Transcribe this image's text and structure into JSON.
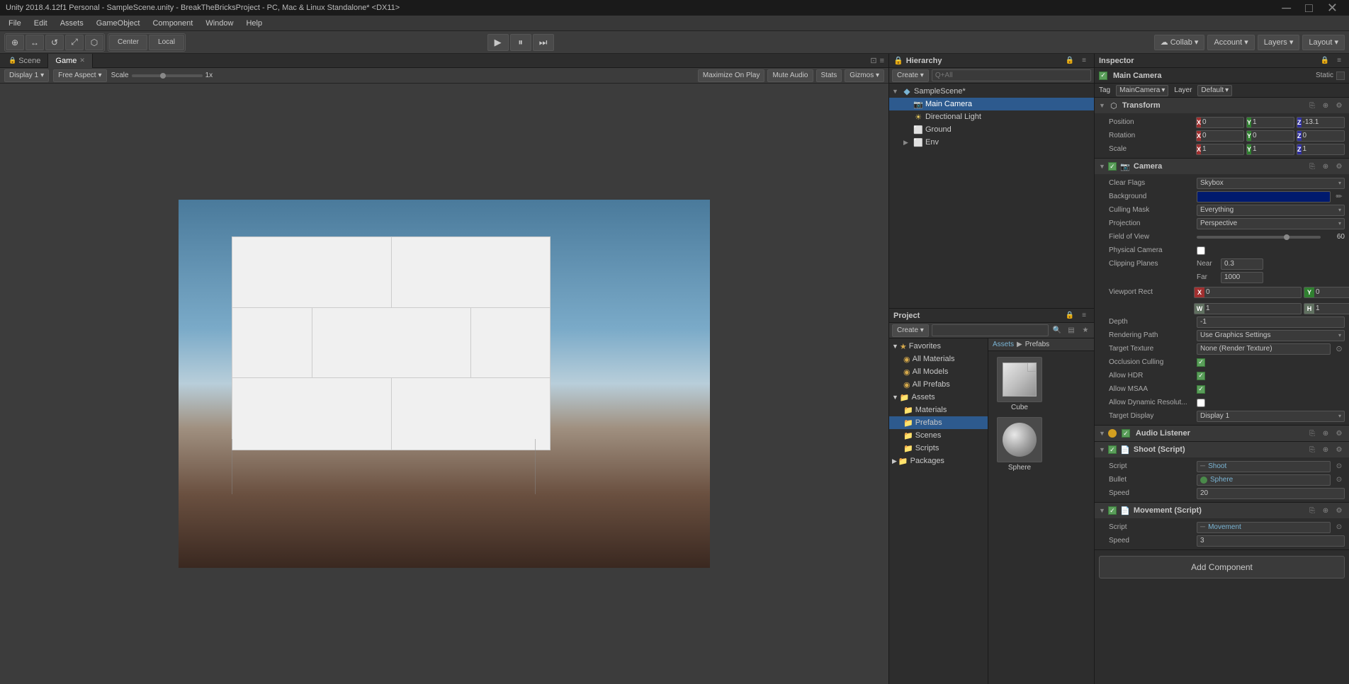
{
  "title_bar": {
    "text": "Unity 2018.4.12f1 Personal - SampleScene.unity - BreakTheBricksProject - PC, Mac & Linux Standalone* <DX11>"
  },
  "menu": {
    "items": [
      "File",
      "Edit",
      "Assets",
      "GameObject",
      "Component",
      "Window",
      "Help"
    ]
  },
  "toolbar": {
    "tools": [
      "⊕",
      "↔",
      "↺",
      "⤢",
      "⬡"
    ],
    "center_label": "Center",
    "local_label": "Local",
    "play_btn": "▶",
    "pause_btn": "⏸",
    "step_btn": "⏭",
    "collab_label": "Collab ▾",
    "cloud_icon": "☁",
    "account_label": "Account ▾",
    "layers_label": "Layers ▾",
    "layout_label": "Layout ▾"
  },
  "scene_tab": {
    "label": "Scene"
  },
  "game_tab": {
    "label": "Game"
  },
  "game_toolbar": {
    "display_label": "Display 1",
    "aspect_label": "Free Aspect",
    "scale_label": "Scale",
    "scale_val": "1x",
    "maximize_label": "Maximize On Play",
    "mute_label": "Mute Audio",
    "stats_label": "Stats",
    "gizmos_label": "Gizmos ▾"
  },
  "hierarchy": {
    "title": "Hierarchy",
    "create_label": "Create ▾",
    "search_placeholder": "Q+All",
    "items": [
      {
        "level": 0,
        "arrow": "▼",
        "name": "SampleScene*",
        "icon": "scene",
        "has_arrow": true
      },
      {
        "level": 1,
        "arrow": "",
        "name": "Main Camera",
        "icon": "camera",
        "selected": true
      },
      {
        "level": 1,
        "arrow": "",
        "name": "Directional Light",
        "icon": "light"
      },
      {
        "level": 1,
        "arrow": "",
        "name": "Ground",
        "icon": "obj"
      },
      {
        "level": 1,
        "arrow": "▶",
        "name": "Env",
        "icon": "obj",
        "has_arrow": true
      }
    ]
  },
  "project": {
    "title": "Project",
    "create_label": "Create ▾",
    "search_placeholder": "",
    "breadcrumb": [
      "Assets",
      "Prefabs"
    ],
    "tree": [
      {
        "level": 0,
        "name": "Favorites",
        "icon": "star",
        "expanded": true
      },
      {
        "level": 1,
        "name": "All Materials",
        "icon": "circle"
      },
      {
        "level": 1,
        "name": "All Models",
        "icon": "circle"
      },
      {
        "level": 1,
        "name": "All Prefabs",
        "icon": "circle"
      },
      {
        "level": 0,
        "name": "Assets",
        "icon": "folder",
        "expanded": true
      },
      {
        "level": 1,
        "name": "Materials",
        "icon": "folder"
      },
      {
        "level": 1,
        "name": "Prefabs",
        "icon": "folder",
        "selected": true
      },
      {
        "level": 1,
        "name": "Scenes",
        "icon": "folder"
      },
      {
        "level": 1,
        "name": "Scripts",
        "icon": "folder"
      },
      {
        "level": 0,
        "name": "Packages",
        "icon": "folder"
      }
    ],
    "assets": [
      {
        "name": "Cube",
        "type": "cube"
      },
      {
        "name": "Sphere",
        "type": "sphere"
      }
    ]
  },
  "inspector": {
    "title": "Inspector",
    "enabled": true,
    "obj_name": "Main Camera",
    "static_label": "Static",
    "tag_label": "Tag",
    "tag_value": "MainCamera",
    "layer_label": "Layer",
    "layer_value": "Default",
    "components": {
      "transform": {
        "name": "Transform",
        "icon": "⬡",
        "position": {
          "x": "0",
          "y": "1",
          "z": "-13.1"
        },
        "rotation": {
          "x": "0",
          "y": "0",
          "z": "0"
        },
        "scale": {
          "x": "1",
          "y": "1",
          "z": "1"
        }
      },
      "camera": {
        "name": "Camera",
        "icon": "📷",
        "clear_flags": "Skybox",
        "background_label": "Background",
        "culling_mask": "Everything",
        "projection": "Perspective",
        "fov_label": "Field of View",
        "fov_value": "60",
        "physical_camera_label": "Physical Camera",
        "clipping_near": "0.3",
        "clipping_far": "1000",
        "viewport_x": "0",
        "viewport_y": "0",
        "viewport_w": "1",
        "viewport_h": "1",
        "depth_label": "Depth",
        "depth_value": "-1",
        "rendering_path_label": "Rendering Path",
        "rendering_path_value": "Use Graphics Settings",
        "target_texture_label": "Target Texture",
        "target_texture_value": "None (Render Texture)",
        "occlusion_culling_label": "Occlusion Culling",
        "allow_hdr_label": "Allow HDR",
        "allow_msaa_label": "Allow MSAA",
        "allow_dynamic_label": "Allow Dynamic Resolut...",
        "target_display_label": "Target Display",
        "target_display_value": "Display 1"
      },
      "audio_listener": {
        "name": "Audio Listener",
        "icon": "🔊"
      },
      "shoot_script": {
        "name": "Shoot (Script)",
        "icon": "📄",
        "script_label": "Script",
        "script_value": "Shoot",
        "bullet_label": "Bullet",
        "bullet_value": "Sphere",
        "speed_label": "Speed",
        "speed_value": "20"
      },
      "movement_script": {
        "name": "Movement (Script)",
        "icon": "📄",
        "script_label": "Script",
        "script_value": "Movement",
        "speed_label": "Speed",
        "speed_value": "3"
      }
    },
    "add_component_label": "Add Component"
  }
}
